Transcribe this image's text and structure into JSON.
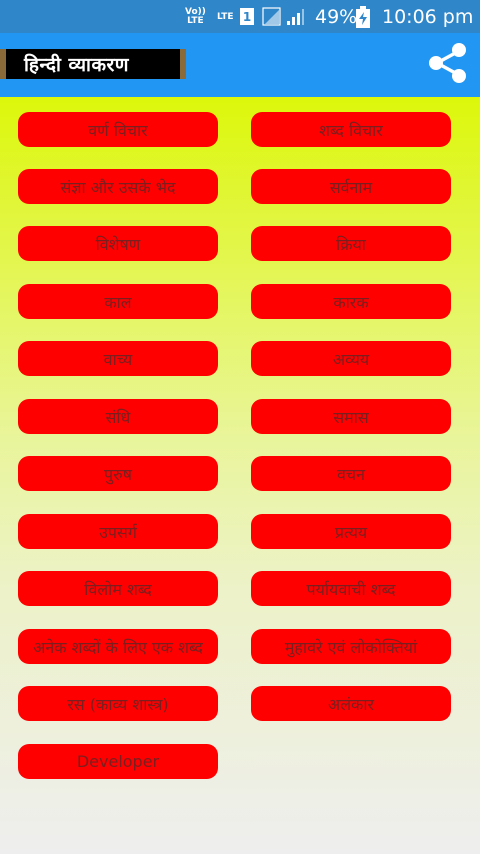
{
  "status_bar": {
    "volte_top": "Vo))",
    "volte_bottom": "LTE",
    "lte": "LTE",
    "sim": "1",
    "battery_percent": "49%",
    "time": "10:06 pm"
  },
  "app_bar": {
    "title": "हिन्दी व्याकरण",
    "share_icon": "share-icon"
  },
  "menu": [
    "वर्ण विचार",
    "शब्द विचार",
    "संज्ञा और उसके भेद",
    "सर्वनाम",
    "विशेषण",
    "क्रिया",
    "काल",
    "कारक",
    "वाच्य",
    "अव्यय",
    "संधि",
    "समास",
    "पुरुष",
    "वचन",
    "उपसर्ग",
    "प्रत्यय",
    "विलोम शब्द",
    "पर्यायवाची शब्द",
    "अनेक शब्दों के लिए एक शब्द",
    "मुहावरे एवं लोकोक्तियां",
    "रस (काव्य शास्त्र)",
    "अलंकार",
    "Developer"
  ],
  "colors": {
    "status_bar": "#2f86c8",
    "app_bar": "#2196f3",
    "button": "#ff0000",
    "button_text": "#7a1f1f"
  }
}
